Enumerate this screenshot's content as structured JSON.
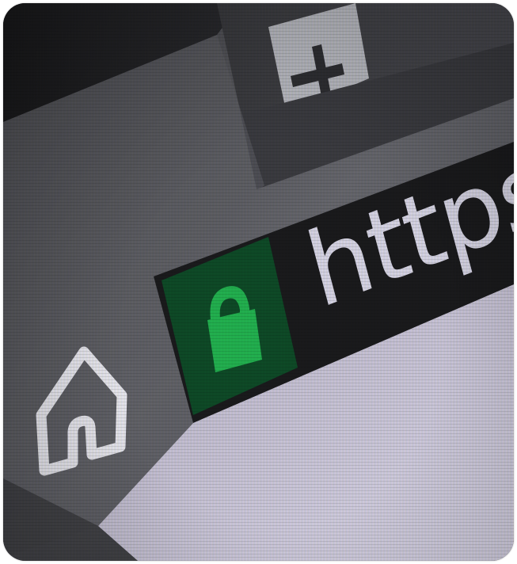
{
  "browser": {
    "address_bar": {
      "url_text": "https:/",
      "secure": true
    },
    "icons": {
      "new_tab": "plus-icon",
      "home": "home-icon",
      "security": "lock-icon"
    }
  },
  "colors": {
    "lock_green": "#1fa34a",
    "lock_bg": "#0f4f2a",
    "address_bar_bg": "#1c1c1e",
    "toolbar_gray": "#6a6a70",
    "page_bg": "#c9c3d6"
  }
}
